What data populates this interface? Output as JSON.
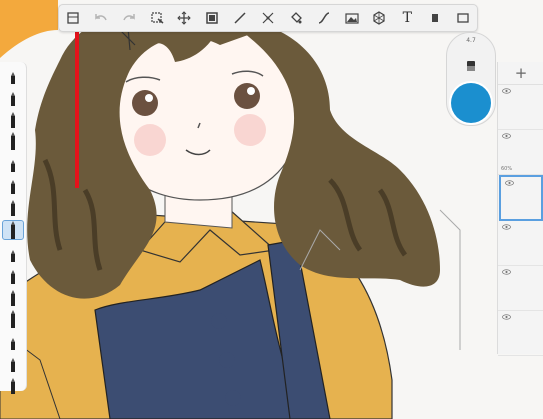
{
  "toolbar": {
    "tools": [
      {
        "icon": "layout-icon",
        "enabled": true
      },
      {
        "icon": "undo-icon",
        "enabled": false
      },
      {
        "icon": "redo-icon",
        "enabled": false
      },
      {
        "icon": "select-icon",
        "enabled": true
      },
      {
        "icon": "transform-icon",
        "enabled": true
      },
      {
        "icon": "crop-icon",
        "enabled": true
      },
      {
        "icon": "ruler-icon",
        "enabled": true
      },
      {
        "icon": "symmetry-icon",
        "enabled": true
      },
      {
        "icon": "fill-icon",
        "enabled": true
      },
      {
        "icon": "curve-icon",
        "enabled": true
      },
      {
        "icon": "image-icon",
        "enabled": true
      },
      {
        "icon": "perspective-icon",
        "enabled": true
      },
      {
        "icon": "text-tool-icon",
        "enabled": true
      },
      {
        "icon": "copic-icon",
        "enabled": true
      },
      {
        "icon": "fullscreen-icon",
        "enabled": true
      }
    ],
    "text_tool_label": "T"
  },
  "color_panel": {
    "brush_size": "4.7",
    "current_color": "#1b8fcf"
  },
  "layers": {
    "add_label": "+",
    "items": [
      {
        "label": "",
        "selected": false
      },
      {
        "label": "60%",
        "selected": false
      },
      {
        "label": "",
        "selected": true
      },
      {
        "label": "",
        "selected": false
      },
      {
        "label": "",
        "selected": false
      },
      {
        "label": "",
        "selected": false
      }
    ]
  },
  "brushes": {
    "count": 15,
    "selected_index": 7
  },
  "colors": {
    "hair": "#6b5a3b",
    "hair_dark": "#4a3d27",
    "skin": "#fff6f1",
    "shirt": "#e6b24f",
    "overall": "#3c4d72",
    "orange": "#f3a93d",
    "annotation_arrow": "#e5121b"
  }
}
